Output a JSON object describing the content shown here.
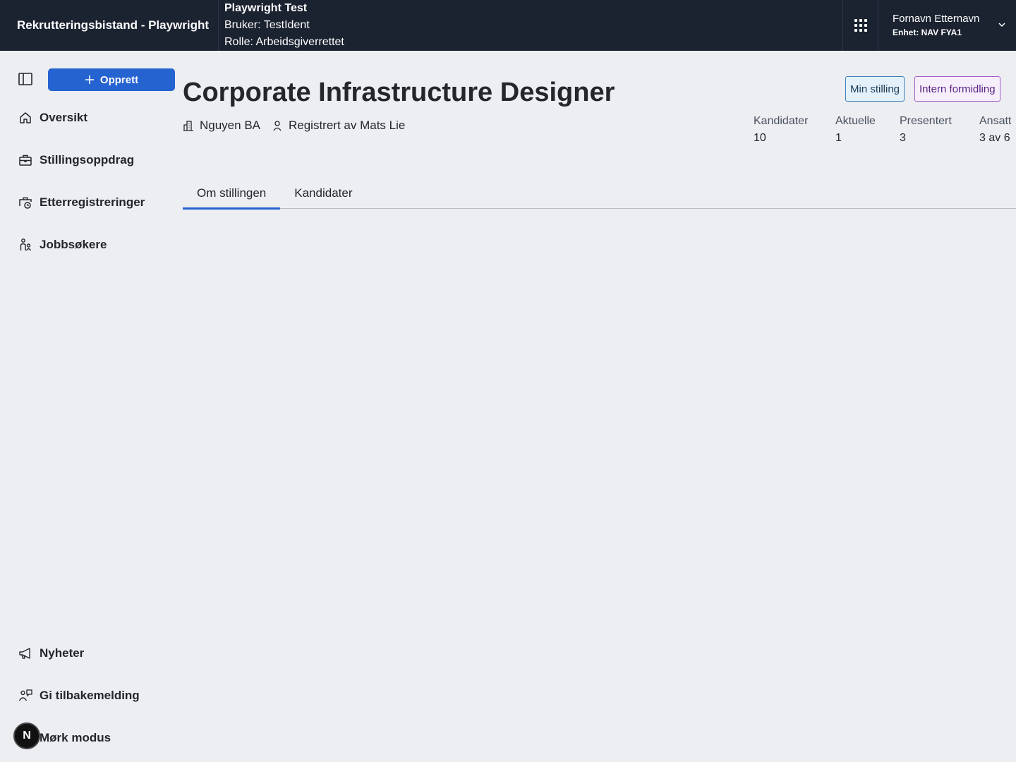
{
  "header": {
    "brand": "Rekrutteringsbistand - Playwright",
    "test_title": "Playwright Test",
    "test_user": "Bruker: TestIdent",
    "test_role": "Rolle: Arbeidsgiverrettet",
    "user_name": "Fornavn Etternavn",
    "user_unit": "Enhet: NAV FYA1"
  },
  "sidebar": {
    "create_label": "Opprett",
    "items": [
      {
        "label": "Oversikt",
        "icon": "home-icon"
      },
      {
        "label": "Stillingsoppdrag",
        "icon": "briefcase-icon"
      },
      {
        "label": "Etterregistreringer",
        "icon": "briefcase-clock-icon"
      },
      {
        "label": "Jobbsøkere",
        "icon": "people-icon"
      }
    ],
    "bottom_items": [
      {
        "label": "Nyheter",
        "icon": "megaphone-icon"
      },
      {
        "label": "Gi tilbakemelding",
        "icon": "feedback-icon"
      },
      {
        "label": "Mørk modus",
        "icon": "moon-icon"
      }
    ],
    "badge_letter": "N"
  },
  "main": {
    "title": "Corporate Infrastructure Designer",
    "employer": "Nguyen BA",
    "registered_by": "Registrert av Mats Lie",
    "tags": {
      "min": "Min stilling",
      "intern": "Intern formidling"
    },
    "stats": [
      {
        "label": "Kandidater",
        "value": "10"
      },
      {
        "label": "Aktuelle",
        "value": "1"
      },
      {
        "label": "Presentert",
        "value": "3"
      },
      {
        "label": "Ansatt",
        "value": "3 av 6"
      }
    ],
    "tabs": [
      {
        "label": "Om stillingen",
        "active": true
      },
      {
        "label": "Kandidater",
        "active": false
      }
    ]
  },
  "colors": {
    "topbar": "#1b2230",
    "accent": "#2463d0",
    "background": "#eceef1"
  }
}
